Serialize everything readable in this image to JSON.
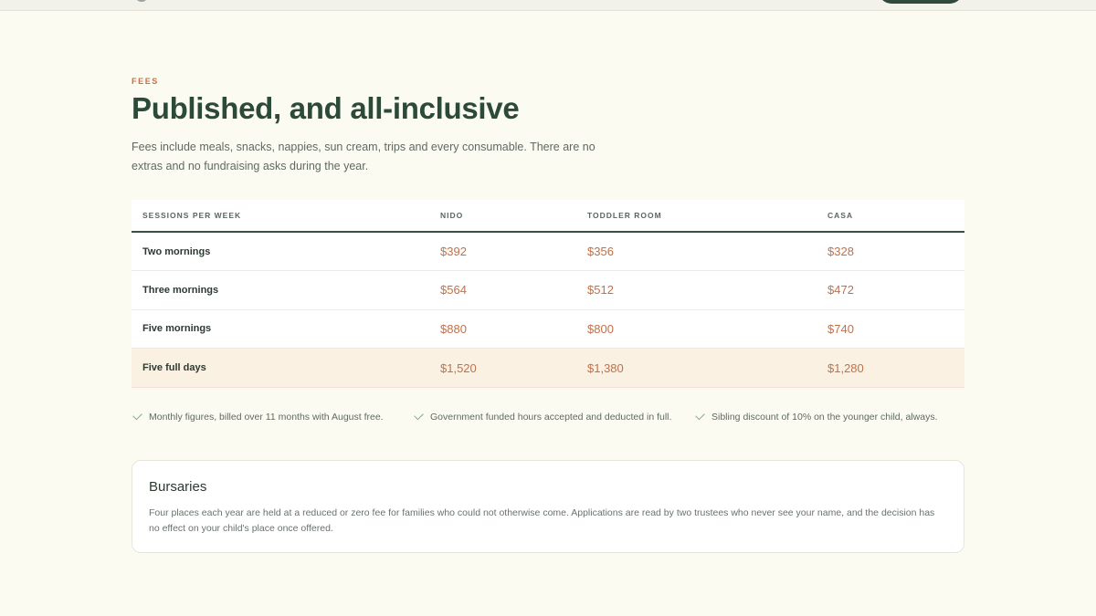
{
  "section": {
    "eyebrow": "FEES",
    "title": "Published, and all-inclusive",
    "intro": "Fees include meals, snacks, nappies, sun cream, trips and every consumable. There are no extras and no fundraising asks during the year."
  },
  "table": {
    "headers": [
      "SESSIONS PER WEEK",
      "NIDO",
      "TODDLER ROOM",
      "CASA"
    ],
    "rows": [
      {
        "label": "Two mornings",
        "nido": "$392",
        "toddler": "$356",
        "casa": "$328"
      },
      {
        "label": "Three mornings",
        "nido": "$564",
        "toddler": "$512",
        "casa": "$472"
      },
      {
        "label": "Five mornings",
        "nido": "$880",
        "toddler": "$800",
        "casa": "$740"
      },
      {
        "label": "Five full days",
        "nido": "$1,520",
        "toddler": "$1,380",
        "casa": "$1,280"
      }
    ]
  },
  "notes": [
    "Monthly figures, billed over 11 months with August free.",
    "Government funded hours accepted and deducted in full.",
    "Sibling discount of 10% on the younger child, always."
  ],
  "bursary": {
    "title": "Bursaries",
    "body": "Four places each year are held at a reduced or zero fee for families who could not otherwise come. Applications are read by two trustees who never see your name, and the decision has no effect on your child's place once offered."
  }
}
